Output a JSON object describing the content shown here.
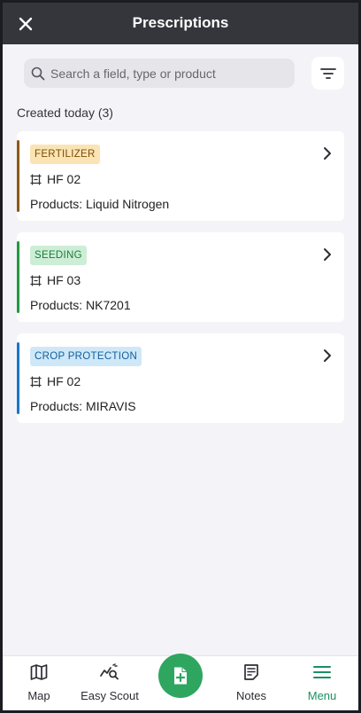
{
  "header": {
    "title": "Prescriptions",
    "close_icon": "close-icon"
  },
  "search": {
    "placeholder": "Search a field, type or product",
    "value": ""
  },
  "filter": {
    "icon": "filter-icon"
  },
  "section": {
    "title": "Created today (3)"
  },
  "cards": [
    {
      "badge": "FERTILIZER",
      "field": "HF 02",
      "products": "Products: Liquid Nitrogen",
      "bar_color": "#8c5a14",
      "badge_bg": "#fbe4b3",
      "badge_color": "#7a4d0a"
    },
    {
      "badge": "SEEDING",
      "field": "HF 03",
      "products": "Products: NK7201",
      "bar_color": "#22983e",
      "badge_bg": "#cdeed6",
      "badge_color": "#1d7a37"
    },
    {
      "badge": "CROP PROTECTION",
      "field": "HF 02",
      "products": "Products: MIRAVIS",
      "bar_color": "#1977c8",
      "badge_bg": "#cfe8f8",
      "badge_color": "#115f9c"
    }
  ],
  "nav": {
    "items": [
      {
        "label": "Map",
        "icon": "map-icon"
      },
      {
        "label": "Easy Scout",
        "icon": "scout-icon"
      },
      {
        "label": "Notes",
        "icon": "notes-icon"
      },
      {
        "label": "Menu",
        "icon": "menu-icon",
        "active": true
      }
    ],
    "fab_icon": "add-file-icon"
  },
  "colors": {
    "header_bg": "#35363c",
    "accent": "#2ea660",
    "active_nav": "#1b8f62",
    "page_bg": "#f4f4f8"
  }
}
